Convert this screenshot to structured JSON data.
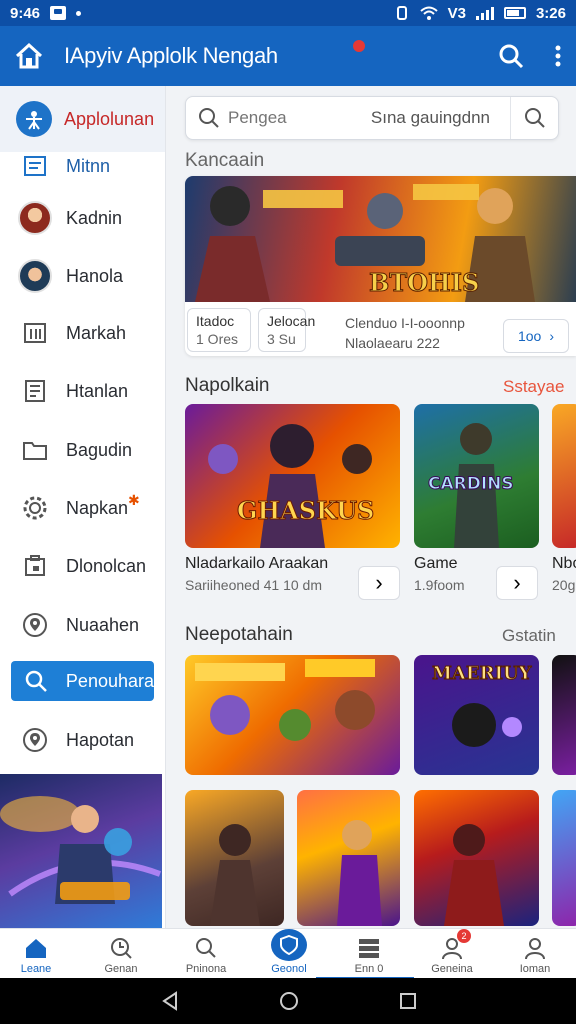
{
  "status_bar": {
    "time_left": "9:46",
    "time_right": "3:26",
    "signal": "V3"
  },
  "app_bar": {
    "title": "IApyiv Applolk Nengah"
  },
  "sidebar": {
    "header_label": "Applolunan",
    "items": [
      {
        "label": "Mitnn",
        "icon": "list-icon"
      },
      {
        "label": "Kadnin",
        "icon": "avatar"
      },
      {
        "label": "Hanola",
        "icon": "avatar"
      },
      {
        "label": "Markah",
        "icon": "building-icon"
      },
      {
        "label": "Htanlan",
        "icon": "document-icon"
      },
      {
        "label": "Bagudin",
        "icon": "folder-icon"
      },
      {
        "label": "Napkan",
        "icon": "gear-icon"
      },
      {
        "label": "Dlonolcan",
        "icon": "calendar-icon"
      },
      {
        "label": "Nuaahen",
        "icon": "location-icon"
      },
      {
        "label": "Penouhara",
        "icon": "search-icon",
        "active": true
      },
      {
        "label": "Hapotan",
        "icon": "location-icon"
      }
    ]
  },
  "search": {
    "placeholder": "Pengea",
    "hint": "Sına gauingdnn"
  },
  "sections": {
    "featured": {
      "title": "Kancaain",
      "banner_text": "BTOHIS",
      "chip1_line1": "Itadoc",
      "chip1_line2": "1 Ores",
      "chip2_line1": "Jelocan",
      "chip2_line2": "3 Su",
      "info_line1": "Clenduo  I-I-ooonnp",
      "info_line2": "Nlaolaearu 222",
      "more_label": "1oo"
    },
    "popular": {
      "title": "Napolkain",
      "more": "Sstayae",
      "card1_art_text": "GHASKUS",
      "card1_title": "Nladarkailo Araakan",
      "card1_sub": "Sariiheoned 41 10 dm",
      "card2_art_text": "CARDINS",
      "card2_title": "Game",
      "card2_sub": "1.9foom",
      "card3_title": "Nbo",
      "card3_sub": "20g"
    },
    "recent": {
      "title": "Neepotahain",
      "more": "Gstatin",
      "card2_art_text": "MAERIUY"
    }
  },
  "bottom_nav": [
    {
      "label": "Leane",
      "icon": "home-icon"
    },
    {
      "label": "Genan",
      "icon": "clock-search-icon"
    },
    {
      "label": "Pninona",
      "icon": "search-icon"
    },
    {
      "label": "Geonol",
      "icon": "shield-icon"
    },
    {
      "label": "Enn 0",
      "icon": "stack-icon"
    },
    {
      "label": "Geneina",
      "icon": "profile-icon",
      "badge": "2"
    },
    {
      "label": "Ioman",
      "icon": "user-icon"
    }
  ],
  "colors": {
    "primary": "#1565c0",
    "accent_red": "#c62828",
    "orange_link": "#e8553d"
  }
}
